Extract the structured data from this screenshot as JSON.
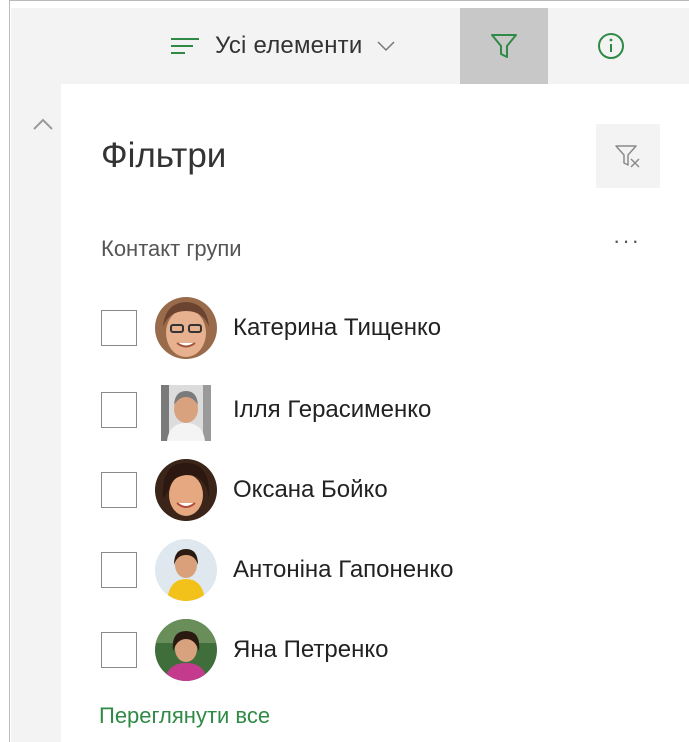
{
  "toolbar": {
    "view_label": "Усі елементи",
    "view_icon": "list-lines-icon",
    "filter_icon": "filter-icon",
    "info_icon": "info-icon",
    "accent_color": "#2f8a45"
  },
  "filters": {
    "title": "Фільтри",
    "clear_icon": "clear-filter-icon",
    "section": {
      "title": "Контакт групи",
      "more_label": "···",
      "people": [
        {
          "name": "Катерина Тищенко",
          "checked": false
        },
        {
          "name": "Ілля Герасименко",
          "checked": false
        },
        {
          "name": "Оксана Бойко",
          "checked": false
        },
        {
          "name": "Антоніна Гапоненко",
          "checked": false
        },
        {
          "name": "Яна Петренко",
          "checked": false
        }
      ],
      "see_all": "Переглянути все"
    }
  }
}
